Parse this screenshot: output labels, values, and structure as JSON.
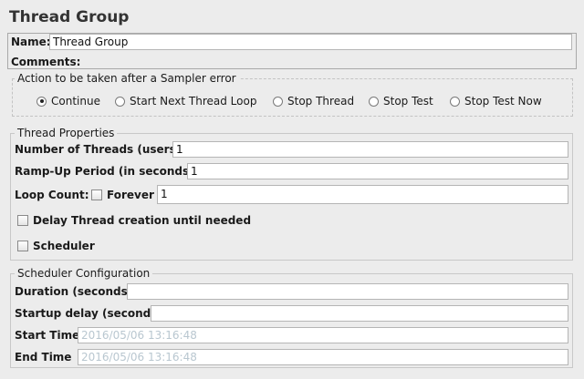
{
  "page": {
    "title": "Thread Group"
  },
  "name_field": {
    "label": "Name:",
    "value": "Thread Group"
  },
  "comments": {
    "label": "Comments:"
  },
  "sampler_error": {
    "legend": "Action to be taken after a Sampler error",
    "options": [
      {
        "label": "Continue",
        "selected": true
      },
      {
        "label": "Start Next Thread Loop",
        "selected": false
      },
      {
        "label": "Stop Thread",
        "selected": false
      },
      {
        "label": "Stop Test",
        "selected": false
      },
      {
        "label": "Stop Test Now",
        "selected": false
      }
    ]
  },
  "thread_props": {
    "legend": "Thread Properties",
    "threads": {
      "label": "Number of Threads (users):",
      "value": "1"
    },
    "rampup": {
      "label": "Ramp-Up Period (in seconds):",
      "value": "1"
    },
    "loop": {
      "label": "Loop Count:",
      "forever_label": "Forever",
      "forever_checked": false,
      "value": "1"
    },
    "delay": {
      "label": "Delay Thread creation until needed",
      "checked": false
    },
    "scheduler": {
      "label": "Scheduler",
      "checked": false
    }
  },
  "scheduler_config": {
    "legend": "Scheduler Configuration",
    "duration": {
      "label": "Duration (seconds)",
      "value": ""
    },
    "startup_delay": {
      "label": "Startup delay (seconds)",
      "value": ""
    },
    "start_time": {
      "label": "Start Time",
      "value": "2016/05/06 13:16:48"
    },
    "end_time": {
      "label": "End Time",
      "value": "2016/05/06 13:16:48"
    }
  }
}
